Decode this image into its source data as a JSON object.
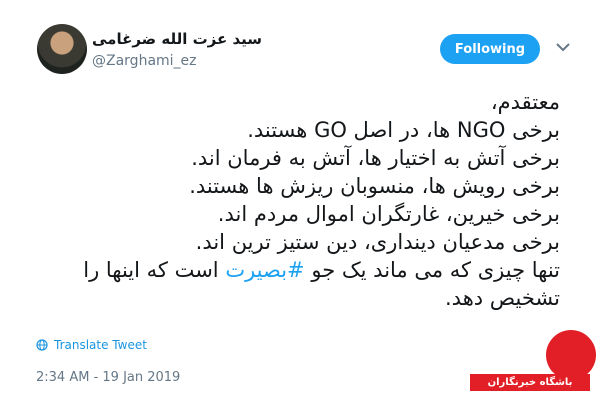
{
  "header": {
    "display_name": "سید عزت الله ضرغامی",
    "handle": "@Zarghami_ez",
    "follow_label": "Following"
  },
  "tweet": {
    "lines": [
      "معتقدم،",
      "برخی NGO ها، در اصل GO هستند.",
      "برخی آتش به اختیار ها، آتش به فرمان اند.",
      "برخی رویش ها، منسوبان ریزش ها هستند.",
      "برخی خیرین، غارتگران اموال مردم اند.",
      "برخی مدعیان دینداری، دین ستیز ترین اند."
    ],
    "line7_before": "تنها چیزی که می ماند یک جو ",
    "hashtag": "#بصیرت",
    "line7_after": " است که اینها را",
    "line8": "تشخیص دهد."
  },
  "translate_label": "Translate Tweet",
  "timestamp": "2:34 AM - 19 Jan 2019",
  "watermark": {
    "text": "باشگاه خبرنگاران"
  },
  "colors": {
    "accent": "#1da1f2",
    "watermark_red": "#e21f26"
  },
  "icons": {
    "translate": "globe-icon",
    "menu": "chevron-down-icon"
  }
}
